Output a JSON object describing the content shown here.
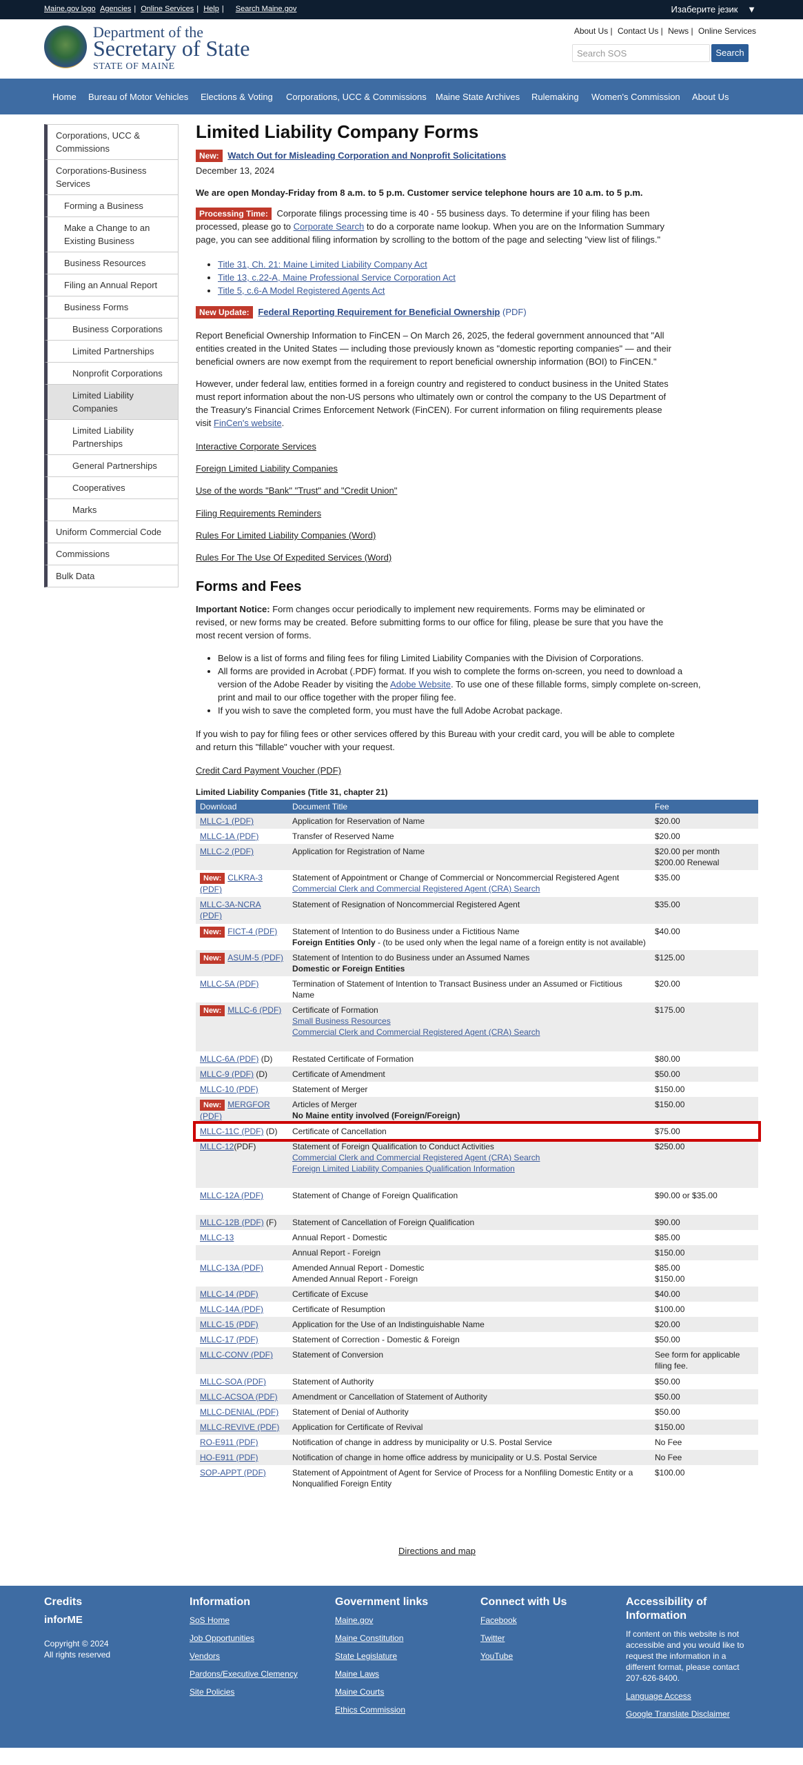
{
  "topbar": {
    "logo_alt": "Maine.gov logo",
    "links": [
      "Agencies",
      "Online Services",
      "Help"
    ],
    "search_link": "Search Maine.gov",
    "language": "Изаберите језик"
  },
  "header": {
    "line1": "Department of the",
    "line2": "Secretary of State",
    "line3": "STATE OF MAINE",
    "links": [
      "About Us",
      "Contact Us",
      "News",
      "Online Services"
    ],
    "search_placeholder": "Search SOS",
    "search_button": "Search"
  },
  "nav": [
    "Home",
    "Bureau of Motor Vehicles",
    "Elections & Voting",
    "Corporations, UCC & Commissions",
    "Maine State Archives",
    "Rulemaking",
    "Women's Commission",
    "About Us"
  ],
  "sidebar": [
    {
      "label": "Corporations, UCC & Commissions",
      "level": 1
    },
    {
      "label": "Corporations-Business Services",
      "level": 1
    },
    {
      "label": "Forming a Business",
      "level": 2
    },
    {
      "label": "Make a Change to an Existing Business",
      "level": 2
    },
    {
      "label": "Business Resources",
      "level": 2
    },
    {
      "label": "Filing an Annual Report",
      "level": 2
    },
    {
      "label": "Business Forms",
      "level": 2
    },
    {
      "label": "Business Corporations",
      "level": 3
    },
    {
      "label": "Limited Partnerships",
      "level": 3
    },
    {
      "label": "Nonprofit Corporations",
      "level": 3
    },
    {
      "label": "Limited Liability Companies",
      "level": 3,
      "active": true
    },
    {
      "label": "Limited Liability Partnerships",
      "level": 3
    },
    {
      "label": "General Partnerships",
      "level": 3
    },
    {
      "label": "Cooperatives",
      "level": 3
    },
    {
      "label": "Marks",
      "level": 3
    },
    {
      "label": "Uniform Commercial Code",
      "level": 1
    },
    {
      "label": "Commissions",
      "level": 1
    },
    {
      "label": "Bulk Data",
      "level": 1
    }
  ],
  "page": {
    "title": "Limited Liability Company Forms",
    "new_badge": "New:",
    "alert_link": "Watch Out for Misleading Corporation and Nonprofit Solicitations",
    "date": "December 13, 2024",
    "hours": "We are open Monday-Friday from 8 a.m. to 5 p.m. Customer service telephone hours are 10 a.m. to 5 p.m.",
    "processing_badge": "Processing Time:",
    "processing_a": " Corporate filings processing time is 40 - 55 business days. To determine if your filing has been processed, please go to ",
    "processing_link": "Corporate Search",
    "processing_b": " to do a corporate name lookup. When you are on the Information Summary page, you can see additional filing information by scrolling to the bottom of the page and selecting \"view list of filings.\"",
    "title_links": [
      "Title 31, Ch. 21: Maine Limited Liability Company Act",
      "Title 13, c.22-A, Maine Professional Service Corporation Act",
      "Title 5, c.6-A Model Registered Agents Act"
    ],
    "update_badge": "New Update:",
    "update_link": "Federal Reporting Requirement for Beneficial Ownership",
    "update_pdf": " (PDF)",
    "boi_p1": "Report Beneficial Ownership Information to FinCEN –  On March 26, 2025, the federal government announced that \"All entities created in the United States — including those previously known as \"domestic reporting companies\" — and their beneficial owners are now exempt from the requirement to report beneficial ownership information (BOI) to FinCEN.\"",
    "boi_p2": "However, under federal law, entities formed in a foreign country and registered to conduct business in the United States must report information about the non-US persons who ultimately own or control the company to the US Department of the Treasury's Financial Crimes Enforcement Network (FinCEN). For current information on filing requirements please visit ",
    "boi_p2_link": "FinCen's website",
    "boi_p2_end": ".",
    "resource_links": [
      "Interactive Corporate Services",
      "Foreign Limited Liability Companies",
      "Use of the words \"Bank\" \"Trust\" and \"Credit Union\"",
      "Filing Requirements Reminders",
      "Rules For Limited Liability Companies (Word)",
      "Rules For The Use Of Expedited Services (Word)"
    ],
    "forms_heading": "Forms and Fees",
    "notice_label": "Important Notice:",
    "notice_text": " Form changes occur periodically to implement new requirements. Forms may be eliminated or revised, or new forms may be created. Before submitting forms to our office for filing, please be sure that you have the most recent version of forms.",
    "bullet1": "Below is a list of forms and filing fees for filing Limited Liability Companies with the Division of Corporations.",
    "bullet2a": "All forms are provided in Acrobat (.PDF) format. If you wish to complete the forms on-screen, you need to download a version of the Adobe Reader by visiting the ",
    "bullet2_link": "Adobe Website",
    "bullet2b": ". To use one of these fillable forms, simply complete on-screen, print and mail to our office together with the proper filing fee.",
    "bullet3": "If you wish to save the completed form, you must have the full Adobe Acrobat package.",
    "pay_text": "If you wish to pay for filing fees or other services offered by this Bureau with your credit card, you will be able to complete and return this \"fillable\" voucher with your request.",
    "voucher_link": "Credit Card Payment Voucher (PDF)",
    "table_caption": "Limited Liability Companies (Title 31, chapter 21)",
    "directions_link": "Directions and map"
  },
  "table": {
    "headers": [
      "Download",
      "Document Title",
      "Fee"
    ],
    "rows": [
      {
        "new": false,
        "link": "MLLC-1 (PDF)",
        "suffix": "",
        "title": "Application for Reservation of Name",
        "fee": "$20.00"
      },
      {
        "new": false,
        "link": "MLLC-1A (PDF)",
        "suffix": "",
        "title": "Transfer of Reserved Name",
        "fee": "$20.00"
      },
      {
        "new": false,
        "link": "MLLC-2 (PDF)",
        "suffix": "",
        "title": "Application for Registration of Name",
        "fee": "$20.00 per month\n$200.00 Renewal"
      },
      {
        "new": true,
        "link": "CLKRA-3 (PDF)",
        "suffix": "",
        "title": "Statement of Appointment or Change of Commercial or Noncommercial Registered Agent",
        "title_links": [
          "Commercial Clerk and Commercial Registered Agent (CRA) Search"
        ],
        "fee": "$35.00"
      },
      {
        "new": false,
        "link": "MLLC-3A-NCRA (PDF)",
        "suffix": "",
        "title": "Statement of Resignation of Noncommercial Registered Agent",
        "fee": "$35.00",
        "tall": true
      },
      {
        "new": true,
        "link": "FICT-4 (PDF)",
        "suffix": "",
        "title": "Statement of Intention to do Business under a Fictitious Name",
        "title_bold": "Foreign Entities Only",
        "title_note": " - (to be used only when the legal name of a foreign entity is not available)",
        "fee": "$40.00"
      },
      {
        "new": true,
        "link": "ASUM-5 (PDF)",
        "suffix": "",
        "title": "Statement of Intention to do Business under an Assumed Names",
        "title_bold": "Domestic or Foreign Entities",
        "fee": "$125.00"
      },
      {
        "new": false,
        "link": "MLLC-5A (PDF)",
        "suffix": "",
        "title": "Termination of Statement of Intention to Transact Business under an Assumed or Fictitious Name",
        "fee": "$20.00"
      },
      {
        "new": true,
        "link": "MLLC-6 (PDF)",
        "suffix": "",
        "title": "Certificate of Formation",
        "title_links": [
          "Small Business Resources",
          "Commercial Clerk and Commercial Registered Agent (CRA) Search"
        ],
        "fee": "$175.00",
        "tall": true
      },
      {
        "new": false,
        "link": "MLLC-6A (PDF)",
        "suffix": " (D)",
        "title": "Restated Certificate of Formation",
        "fee": "$80.00"
      },
      {
        "new": false,
        "link": "MLLC-9 (PDF)",
        "suffix": " (D)",
        "title": "Certificate of Amendment",
        "fee": "$50.00"
      },
      {
        "new": false,
        "link": "MLLC-10 (PDF)",
        "suffix": "",
        "title": "Statement of Merger",
        "fee": "$150.00"
      },
      {
        "new": true,
        "link": "MERGFOR (PDF)",
        "suffix": "",
        "title": "Articles of Merger",
        "title_bold": "No Maine entity involved (Foreign/Foreign)",
        "fee": "$150.00"
      },
      {
        "new": false,
        "link": "MLLC-11C (PDF)",
        "suffix": " (D)",
        "title": "Certificate of Cancellation",
        "fee": "$75.00",
        "highlight": true
      },
      {
        "new": false,
        "link": "MLLC-12",
        "suffix": "(PDF)",
        "title": "Statement of Foreign Qualification to Conduct Activities",
        "title_links": [
          "Commercial Clerk and Commercial Registered Agent (CRA) Search",
          "Foreign Limited Liability Companies Qualification Information"
        ],
        "fee": "$250.00",
        "tall": true
      },
      {
        "new": false,
        "link": "MLLC-12A (PDF)",
        "suffix": "",
        "title": "Statement of Change of Foreign Qualification",
        "fee": "$90.00 or $35.00",
        "tall": true
      },
      {
        "new": false,
        "link": "MLLC-12B (PDF)",
        "suffix": " (F)",
        "title": "Statement of Cancellation of Foreign Qualification",
        "fee": "$90.00"
      },
      {
        "new": false,
        "link": "MLLC-13",
        "suffix": "",
        "title": "Annual Report - Domestic",
        "fee": "$85.00"
      },
      {
        "new": false,
        "link": "",
        "suffix": "",
        "title": "Annual Report - Foreign",
        "fee": "$150.00"
      },
      {
        "new": false,
        "link": "MLLC-13A (PDF)",
        "suffix": "",
        "title": "Amended Annual Report - Domestic\nAmended Annual Report - Foreign",
        "fee": "$85.00\n$150.00"
      },
      {
        "new": false,
        "link": "MLLC-14 (PDF)",
        "suffix": "",
        "title": "Certificate of Excuse",
        "fee": "$40.00"
      },
      {
        "new": false,
        "link": "MLLC-14A (PDF)",
        "suffix": "",
        "title": "Certificate of Resumption",
        "fee": "$100.00"
      },
      {
        "new": false,
        "link": "MLLC-15 (PDF)",
        "suffix": "",
        "title": "Application for the Use of an Indistinguishable Name",
        "fee": "$20.00"
      },
      {
        "new": false,
        "link": "MLLC-17 (PDF)",
        "suffix": "",
        "title": "Statement of Correction - Domestic & Foreign",
        "fee": "$50.00"
      },
      {
        "new": false,
        "link": "MLLC-CONV (PDF)",
        "suffix": "",
        "title": "Statement of Conversion",
        "fee": "See form for applicable filing fee.",
        "tall": true
      },
      {
        "new": false,
        "link": "MLLC-SOA (PDF)",
        "suffix": "",
        "title": "Statement of Authority",
        "fee": "$50.00"
      },
      {
        "new": false,
        "link": "MLLC-ACSOA (PDF)",
        "suffix": "",
        "title": "Amendment or Cancellation of Statement of Authority",
        "fee": "$50.00"
      },
      {
        "new": false,
        "link": "MLLC-DENIAL (PDF)",
        "suffix": "",
        "title": "Statement of Denial of Authority",
        "fee": "$50.00"
      },
      {
        "new": false,
        "link": "MLLC-REVIVE (PDF)",
        "suffix": "",
        "title": "Application for Certificate of Revival",
        "fee": "$150.00"
      },
      {
        "new": false,
        "link": "RO-E911 (PDF)",
        "suffix": "",
        "title": "Notification of change in address by municipality or U.S. Postal Service",
        "fee": "No Fee"
      },
      {
        "new": false,
        "link": "HO-E911 (PDF)",
        "suffix": "",
        "title": "Notification of change in home office address by municipality or U.S. Postal Service",
        "fee": "No Fee"
      },
      {
        "new": false,
        "link": "SOP-APPT (PDF)",
        "suffix": "",
        "title": "Statement of Appointment of Agent for Service of Process for a Nonfiling Domestic Entity or a Nonqualified Foreign Entity",
        "fee": "$100.00"
      }
    ]
  },
  "footer": {
    "credits_heading": "Credits",
    "credits_logo": "inforME",
    "copyright": "Copyright © 2024",
    "rights": "All rights reserved",
    "info_heading": "Information",
    "info_links": [
      "SoS Home",
      "Job Opportunities",
      "Vendors",
      "Pardons/Executive Clemency",
      "Site Policies"
    ],
    "gov_heading": "Government links",
    "gov_links": [
      "Maine.gov",
      "Maine Constitution",
      "State Legislature",
      "Maine Laws",
      "Maine Courts",
      "Ethics Commission"
    ],
    "connect_heading": "Connect with Us",
    "connect_links": [
      "Facebook",
      "Twitter",
      "YouTube"
    ],
    "access_heading": "Accessibility of Information",
    "access_text": "If content on this website is not accessible and you would like to request the information in a different format, please contact 207-626-8400.",
    "access_links": [
      "Language Access",
      "Google Translate Disclaimer"
    ]
  }
}
